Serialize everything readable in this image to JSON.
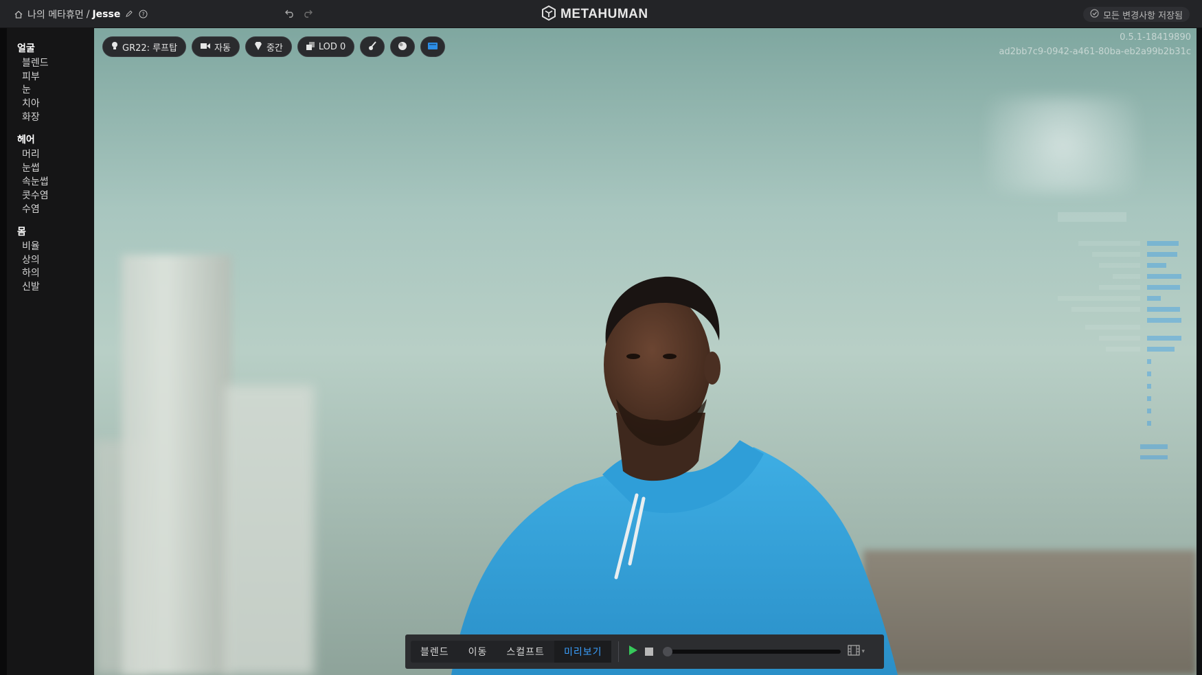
{
  "header": {
    "home_icon": "home-icon",
    "breadcrumb_root": "나의 메타휴먼",
    "breadcrumb_separator": "/",
    "breadcrumb_current": "Jesse",
    "app_name": "METAHUMAN",
    "save_status": "모든 변경사항 저장됨"
  },
  "sidebar": {
    "categories": [
      {
        "label": "얼굴",
        "items": [
          "블렌드",
          "피부",
          "눈",
          "치아",
          "화장"
        ]
      },
      {
        "label": "헤어",
        "items": [
          "머리",
          "눈썹",
          "속눈썹",
          "콧수염",
          "수염"
        ]
      },
      {
        "label": "몸",
        "items": [
          "비율",
          "상의",
          "하의",
          "신발"
        ]
      }
    ]
  },
  "viewport": {
    "toolbar": {
      "lighting": "GR22: 루프탑",
      "camera": "자동",
      "quality": "중간",
      "lod": "LOD 0"
    },
    "version": "0.5.1-18419890",
    "session_id": "ad2bb7c9-0942-a461-80ba-eb2a99b2b31c"
  },
  "playback": {
    "tabs": [
      "블렌드",
      "이동",
      "스컬프트",
      "미리보기"
    ],
    "active_tab": "미리보기",
    "progress": 0
  },
  "colors": {
    "accent": "#3aa0ff",
    "play": "#37c95b",
    "hoodie": "#2f9ed8"
  }
}
